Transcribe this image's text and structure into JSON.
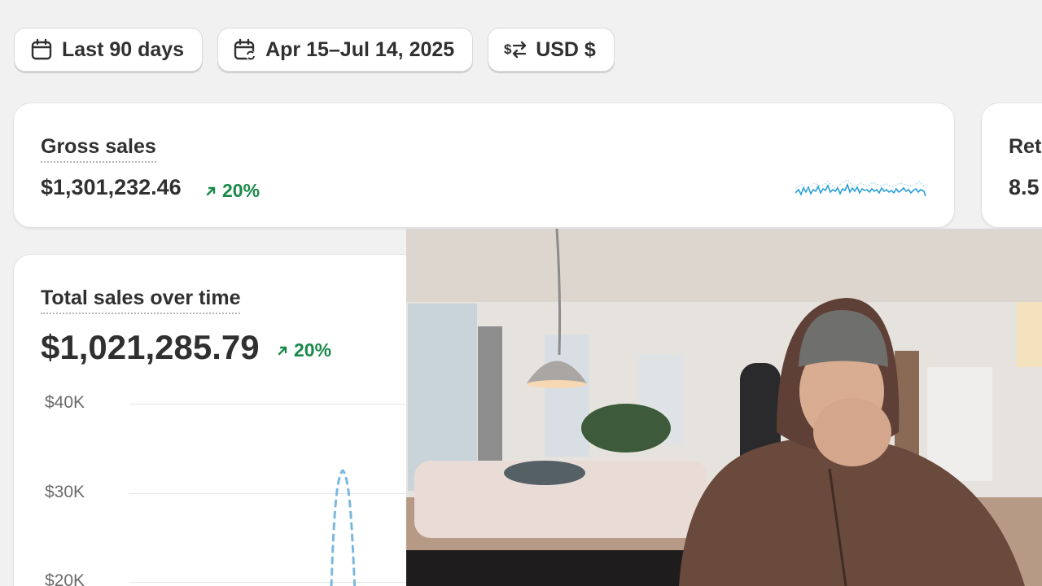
{
  "filters": [
    {
      "icon": "calendar-icon",
      "label": "Last 90 days"
    },
    {
      "icon": "calendar-compare-icon",
      "label": "Apr 15–Jul 14, 2025"
    },
    {
      "icon": "currency-exchange-icon",
      "label": "USD $"
    }
  ],
  "gross_sales": {
    "title": "Gross sales",
    "value": "$1,301,232.46",
    "change": "20%",
    "trend_direction": "up"
  },
  "returns": {
    "title": "Ret",
    "value": "8.5"
  },
  "total_sales": {
    "title": "Total sales over time",
    "value": "$1,021,285.79",
    "change": "20%",
    "trend_direction": "up"
  },
  "chart_data": {
    "type": "line",
    "y_ticks": [
      "$40K",
      "$30K",
      "$20K"
    ],
    "series_color": "#7ab8df",
    "line_style": "dashed"
  },
  "colors": {
    "positive": "#1a8a4a",
    "sparkline": "#2a9fd8",
    "background": "#f1f1f1"
  },
  "webcam": {
    "description_icon": "webcam-overlay"
  }
}
